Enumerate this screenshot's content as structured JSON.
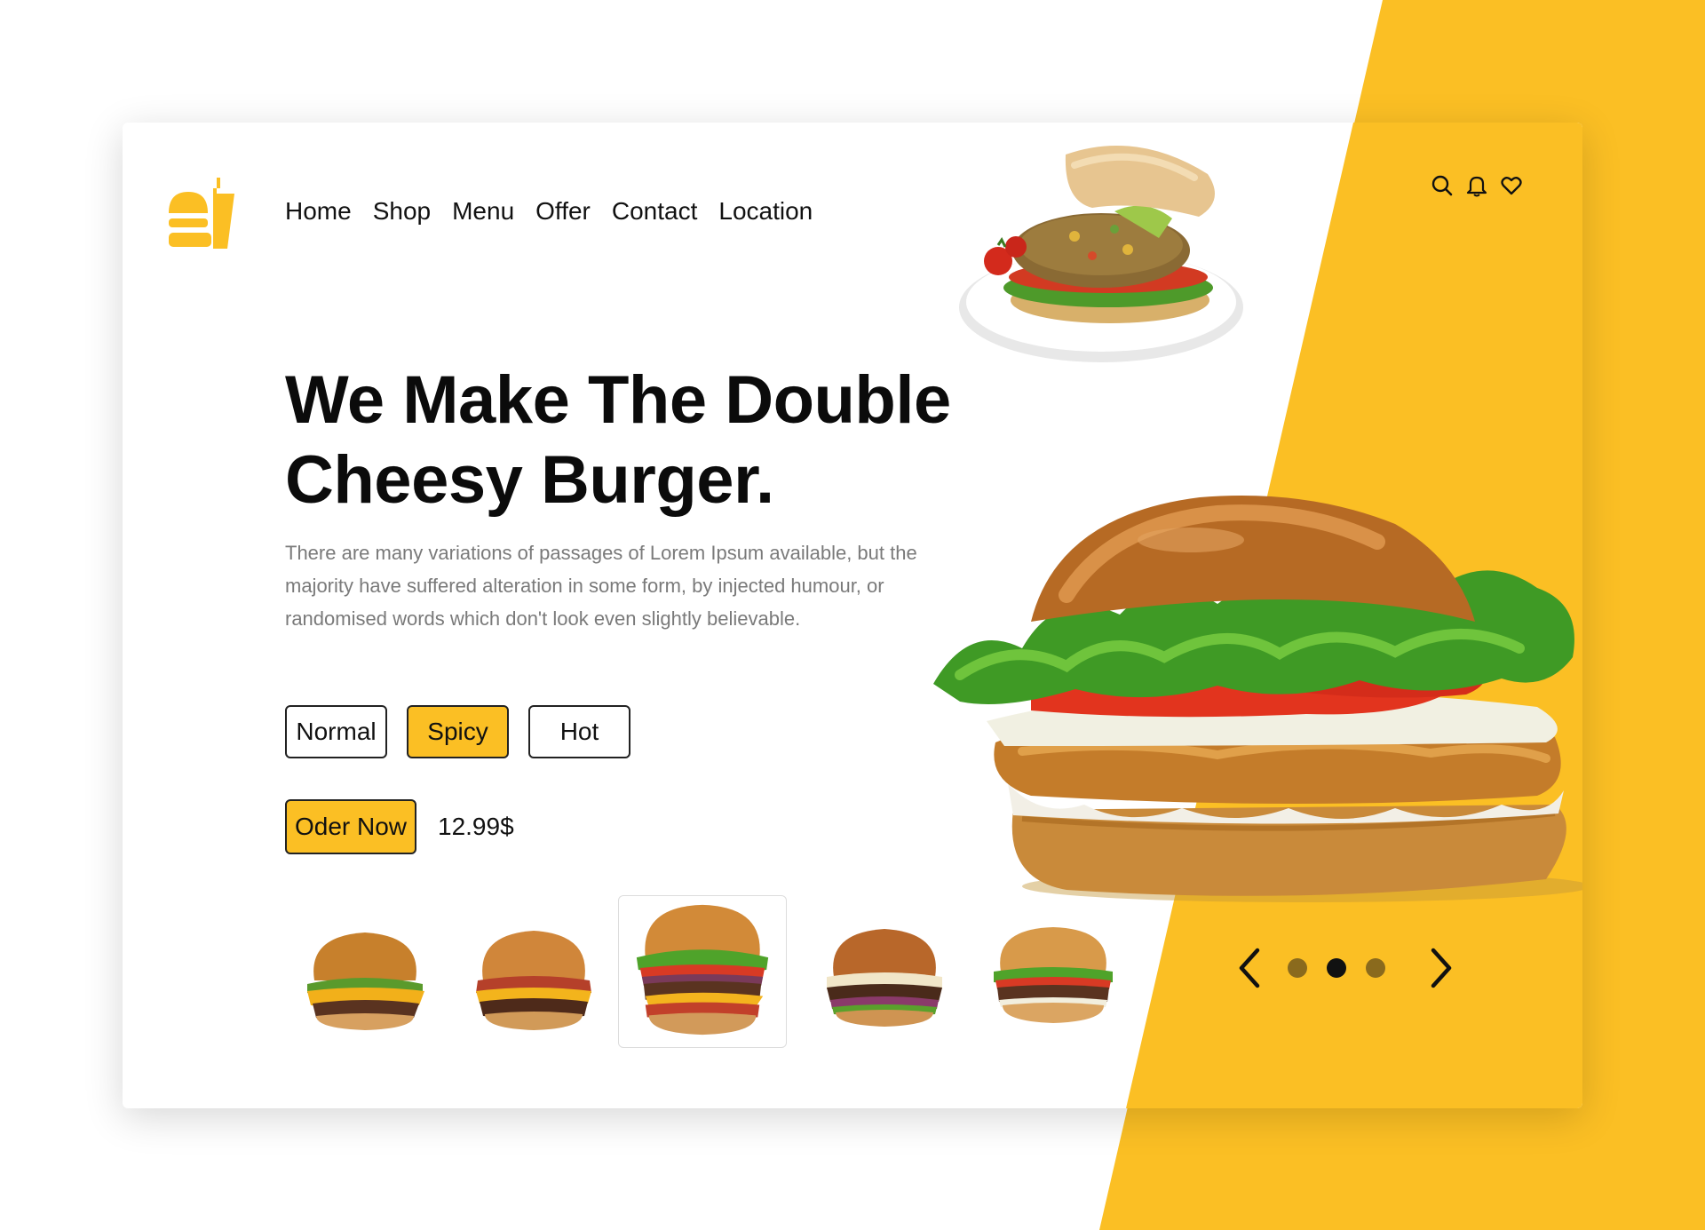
{
  "colors": {
    "accent": "#fbbf24",
    "text": "#111111",
    "muted": "#7a7a7a",
    "dot_inactive": "#8a6a1d",
    "dot_active": "#111111"
  },
  "nav": {
    "items": [
      "Home",
      "Shop",
      "Menu",
      "Offer",
      "Contact",
      "Location"
    ]
  },
  "header_icons": [
    "search-icon",
    "bell-icon",
    "heart-icon"
  ],
  "hero": {
    "title_line1": "We Make The Double",
    "title_line2": "Cheesy Burger.",
    "description": "There are many variations of passages of Lorem Ipsum available, but the majority have suffered alteration in some form, by injected humour, or randomised words which don't look even slightly believable."
  },
  "variants": {
    "options": [
      "Normal",
      "Spicy",
      "Hot"
    ],
    "selected": "Spicy"
  },
  "order": {
    "button_label": "Oder Now",
    "price": "12.99$"
  },
  "gallery": {
    "count": 5,
    "selected_index": 2
  },
  "pager": {
    "pages": 3,
    "active_page": 2
  }
}
